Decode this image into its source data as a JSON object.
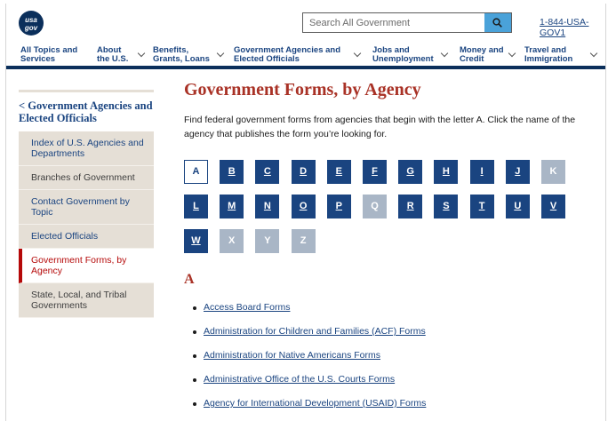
{
  "header": {
    "logo_text": "usa gov",
    "search_placeholder": "Search All Government",
    "phone": "1-844-USA-GOV1"
  },
  "nav": [
    {
      "label_1": "All Topics and",
      "label_2": "Services"
    },
    {
      "label_1": "About",
      "label_2": "the U.S."
    },
    {
      "label_1": "Benefits,",
      "label_2": "Grants, Loans"
    },
    {
      "label_1": "Government Agencies and",
      "label_2": "Elected Officials"
    },
    {
      "label_1": "Jobs and",
      "label_2": "Unemployment"
    },
    {
      "label_1": "Money and",
      "label_2": "Credit"
    },
    {
      "label_1": "Travel and",
      "label_2": "Immigration"
    }
  ],
  "sidebar": {
    "heading": "< Government Agencies and Elected Officials",
    "items": [
      {
        "label": "Index of U.S. Agencies and Departments",
        "state": "link"
      },
      {
        "label": "Branches of Government",
        "state": "plain"
      },
      {
        "label": "Contact Government by Topic",
        "state": "link"
      },
      {
        "label": "Elected Officials",
        "state": "link"
      },
      {
        "label": "Government Forms, by Agency",
        "state": "active"
      },
      {
        "label": "State, Local, and Tribal Governments",
        "state": "plain"
      }
    ]
  },
  "main": {
    "title": "Government Forms, by Agency",
    "intro": "Find federal government forms from agencies that begin with the letter A. Click the name of the agency that publishes the form you’re looking for.",
    "letters": [
      {
        "l": "A",
        "state": "current"
      },
      {
        "l": "B",
        "state": "link"
      },
      {
        "l": "C",
        "state": "link"
      },
      {
        "l": "D",
        "state": "link"
      },
      {
        "l": "E",
        "state": "link"
      },
      {
        "l": "F",
        "state": "link"
      },
      {
        "l": "G",
        "state": "link"
      },
      {
        "l": "H",
        "state": "link"
      },
      {
        "l": "I",
        "state": "link"
      },
      {
        "l": "J",
        "state": "link"
      },
      {
        "l": "K",
        "state": "disabled"
      },
      {
        "l": "L",
        "state": "link"
      },
      {
        "l": "M",
        "state": "link"
      },
      {
        "l": "N",
        "state": "link"
      },
      {
        "l": "O",
        "state": "link"
      },
      {
        "l": "P",
        "state": "link"
      },
      {
        "l": "Q",
        "state": "disabled"
      },
      {
        "l": "R",
        "state": "link"
      },
      {
        "l": "S",
        "state": "link"
      },
      {
        "l": "T",
        "state": "link"
      },
      {
        "l": "U",
        "state": "link"
      },
      {
        "l": "V",
        "state": "link"
      },
      {
        "l": "W",
        "state": "link"
      },
      {
        "l": "X",
        "state": "disabled"
      },
      {
        "l": "Y",
        "state": "disabled"
      },
      {
        "l": "Z",
        "state": "disabled"
      }
    ],
    "section_letter": "A",
    "agencies": [
      "Access Board Forms",
      "Administration for Children and Families (ACF) Forms",
      "Administration for Native Americans Forms",
      "Administrative Office of the U.S. Courts Forms",
      "Agency for International Development (USAID) Forms"
    ]
  },
  "colors": {
    "brand_navy": "#1a4480",
    "title_red": "#a93226",
    "active_red": "#b50909",
    "sidebar_bg": "#e5dfd6",
    "disabled_letter": "#a9b6c6",
    "search_button": "#4aa2d9"
  }
}
